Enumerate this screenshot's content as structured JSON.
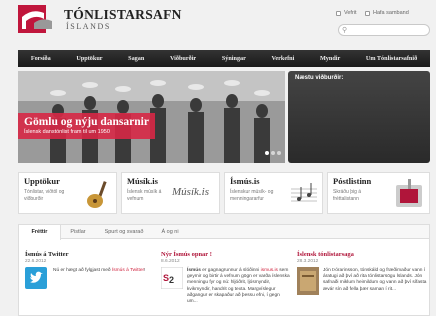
{
  "header": {
    "logo_title": "TÓNLISTARSAFN",
    "logo_sub": "ÍSLANDS",
    "links": [
      {
        "label": "Vefrit"
      },
      {
        "label": "Hafa samband"
      }
    ]
  },
  "nav": [
    "Forsíða",
    "Upptökur",
    "Sagan",
    "Viðburðir",
    "Sýningar",
    "Verkefni",
    "Myndir",
    "Um Tónlistarsafnið"
  ],
  "hero": {
    "title": "Gömlu og nýju dansarnir",
    "subtitle": "Íslensk danstónlist fram til um 1950"
  },
  "events": {
    "title": "Næstu viðburðir:"
  },
  "cards": [
    {
      "title": "Upptökur",
      "desc": "Tónlistar, viðtöl og viðburðir"
    },
    {
      "title": "Músík.is",
      "desc": "Íslensk músík á vefnum",
      "logo_text": "Músík.is"
    },
    {
      "title": "Ísmús.is",
      "desc": "Íslenskur músík- og menningararfur"
    },
    {
      "title": "Póstlistinn",
      "desc": "Skráðu þig á fréttalistann"
    }
  ],
  "tabs": [
    "Fréttir",
    "Pistlar",
    "Spurt og svarað",
    "Á og ni"
  ],
  "columns": [
    {
      "title": "Ísmús á Twitter",
      "date": "22.6.2012",
      "text_before": "Nú er hægt að fylgjast með ",
      "link": "Ísmús á Twitter",
      "text_after": "!"
    },
    {
      "title": "Nýr Ísmús opnar !",
      "date": "8.6.2012",
      "lead": "Ísmús",
      "text_mid": " er gagnagrunnur á slóðinni ",
      "link": "ismus.is",
      "text_after": " sem geymir og birtir á vefnum gögn er varða íslenska menningu fyr og nú: hljóðrit, ljósmyndir, kvikmyndir, handrit og texta. Margvíslegur aðgangur er skapaður að þessu efni, í gegn um..."
    },
    {
      "title": "Íslensk tónlistarsaga",
      "date": "28.3.2012",
      "text_after": "Jón Þórarinsson, tónskáld og fræðimaður vann í áratugi að því að rita tónlistarsögu Íslands. Jón safnaði miklum heimildum og vann að því sífasta ævár sín að fella þær saman í rit..."
    }
  ],
  "colors": {
    "accent": "#d0243f",
    "nav_bg": "#222222",
    "twitter": "#2a9fd8"
  }
}
